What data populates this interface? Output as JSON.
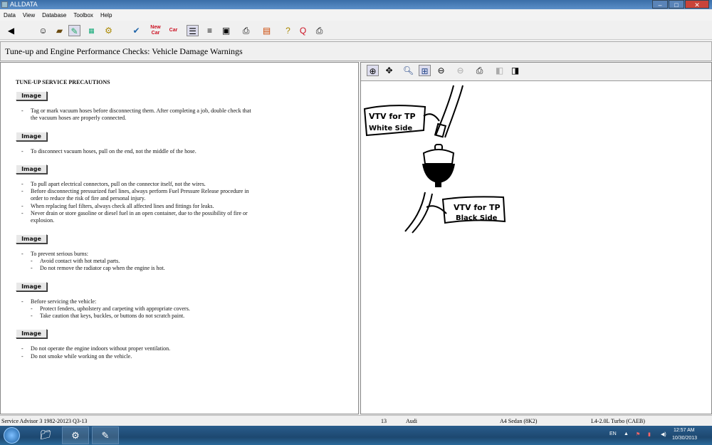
{
  "window": {
    "title": "ALLDATA"
  },
  "menu": [
    "Data",
    "View",
    "Database",
    "Toolbox",
    "Help"
  ],
  "toolbar_icons": [
    "back-icon",
    "face-icon",
    "folder-icon",
    "component-locator-icon",
    "specs-icon",
    "parts-icon",
    "tsb-icon",
    "new-car-icon",
    "previous-car-icon",
    "text-view-icon",
    "list-icon",
    "camera-icon",
    "print-icon",
    "hotline-icon",
    "help-icon",
    "zoom-z-icon",
    "print-all-icon"
  ],
  "toolbar_labels": {
    "new_car": "New Car",
    "prev_car": "Car"
  },
  "header": {
    "title": "Tune-up and Engine Performance Checks:  Vehicle Damage Warnings"
  },
  "doc": {
    "heading": "TUNE-UP SERVICE PRECAUTIONS",
    "image_label": "Image",
    "sections": [
      {
        "items": [
          {
            "t": "Tag or mark vacuum hoses before disconnecting them. After completing a job, double check that the vacuum hoses are properly connected."
          }
        ]
      },
      {
        "items": [
          {
            "t": "To disconnect vacuum hoses, pull on the end, not the middle of the hose."
          }
        ]
      },
      {
        "items": [
          {
            "t": "To pull apart electrical connectors, pull on the connector itself, not the wires."
          },
          {
            "t": "Before disconnecting pressurized fuel lines, always perform Fuel Pressure Release procedure in order to reduce the risk of fire and personal injury."
          },
          {
            "t": "When replacing fuel filters, always check all affected lines and fittings for leaks."
          },
          {
            "t": "Never drain or store gasoline or diesel fuel in an open container, due to the possibility of fire or explosion."
          }
        ]
      },
      {
        "items": [
          {
            "t": "To prevent serious burns:"
          },
          {
            "t": "Avoid contact with hot metal parts.",
            "sub": true
          },
          {
            "t": "Do not remove the radiator cap when the engine is hot.",
            "sub": true
          }
        ]
      },
      {
        "items": [
          {
            "t": "Before servicing the vehicle:"
          },
          {
            "t": "Protect fenders, upholstery and carpeting with appropriate covers.",
            "sub": true
          },
          {
            "t": "Take caution that keys, buckles, or buttons do not scratch paint.",
            "sub": true
          }
        ]
      },
      {
        "items": [
          {
            "t": "Do not operate the engine indoors without proper ventilation."
          },
          {
            "t": "Do not smoke while working on the vehicle."
          }
        ]
      }
    ]
  },
  "viewer": {
    "tools": [
      "zoom-in-icon",
      "pan-icon",
      "zoom-region-icon",
      "fit-icon",
      "zoom-out-step-icon",
      "zoom-out-icon",
      "print-icon",
      "prev-image-icon",
      "next-image-icon"
    ],
    "illustration": {
      "label_top_1": "VTV for TP",
      "label_top_2": "White Side",
      "label_bottom_1": "VTV for TP",
      "label_bottom_2": "Black Side"
    }
  },
  "status": {
    "product": "Service Advisor 3 1982-20123 Q3-13",
    "num": "13",
    "make": "Audi",
    "model": "A4 Sedan (8K2)",
    "engine": "L4-2.0L Turbo (CAEB)"
  },
  "taskbar": {
    "lang": "EN",
    "time": "12:57 AM",
    "date": "10/30/2013"
  }
}
